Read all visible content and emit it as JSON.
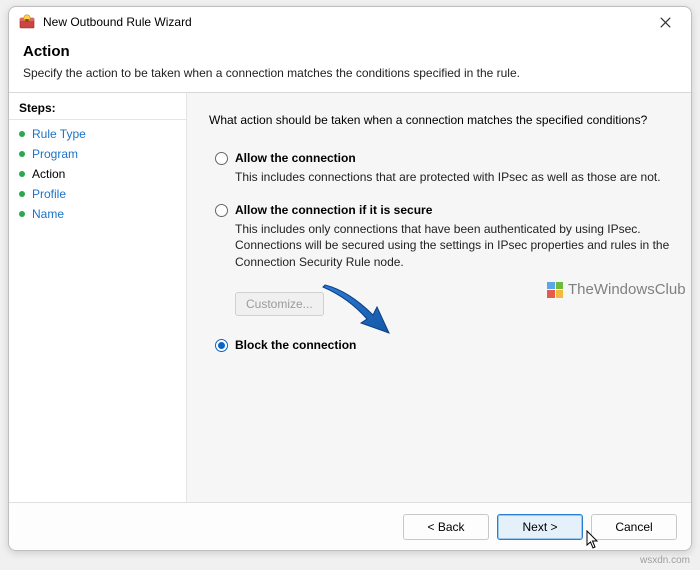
{
  "window": {
    "title": "New Outbound Rule Wizard"
  },
  "header": {
    "title": "Action",
    "subtitle": "Specify the action to be taken when a connection matches the conditions specified in the rule."
  },
  "sidebar": {
    "label": "Steps:",
    "items": [
      {
        "label": "Rule Type"
      },
      {
        "label": "Program"
      },
      {
        "label": "Action"
      },
      {
        "label": "Profile"
      },
      {
        "label": "Name"
      }
    ],
    "current_index": 2
  },
  "content": {
    "question": "What action should be taken when a connection matches the specified conditions?",
    "options": [
      {
        "label": "Allow the connection",
        "desc": "This includes connections that are protected with IPsec as well as those are not.",
        "selected": false
      },
      {
        "label": "Allow the connection if it is secure",
        "desc": "This includes only connections that have been authenticated by using IPsec. Connections will be secured using the settings in IPsec properties and rules in the Connection Security Rule node.",
        "selected": false
      },
      {
        "label": "Block the connection",
        "desc": "",
        "selected": true
      }
    ],
    "customize_label": "Customize..."
  },
  "watermark": {
    "text": "TheWindowsClub"
  },
  "footer": {
    "back": "< Back",
    "next": "Next >",
    "cancel": "Cancel"
  },
  "credit": "wsxdn.com"
}
